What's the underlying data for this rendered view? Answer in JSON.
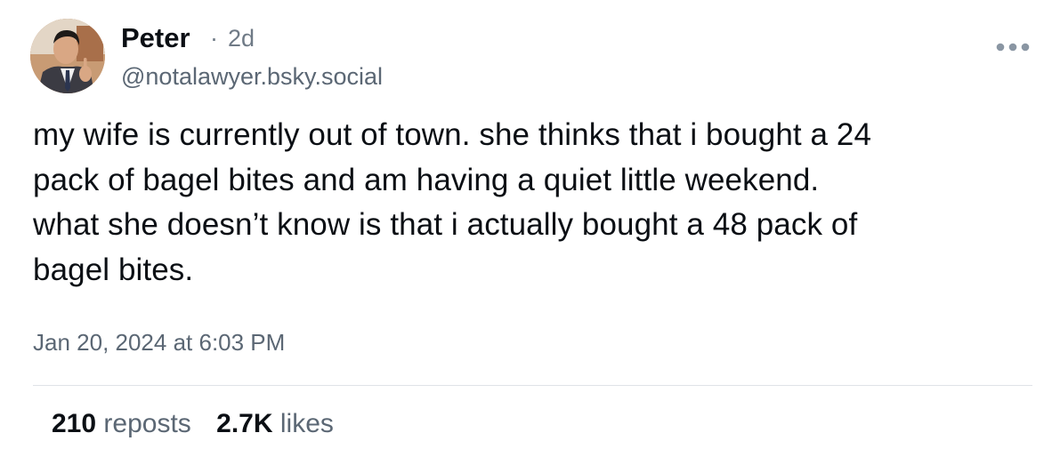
{
  "post": {
    "author": {
      "display_name": "Peter",
      "handle": "@notalawyer.bsky.social",
      "time_ago": "2d",
      "separator": "·"
    },
    "text": "my wife is currently out of town. she thinks that i bought a 24\npack of bagel bites and am having a quiet little weekend.\nwhat she doesn’t know is that i actually bought a 48 pack of\nbagel bites.",
    "timestamp": "Jan 20, 2024 at 6:03 PM",
    "stats": {
      "reposts_count": "210",
      "reposts_label": "reposts",
      "likes_count": "2.7K",
      "likes_label": "likes"
    },
    "more_icon": "more-horizontal-icon"
  },
  "colors": {
    "text_primary": "#0b0f14",
    "text_secondary": "#5b6774",
    "divider": "#dfe3e7",
    "more_icon": "#8a96a3"
  }
}
